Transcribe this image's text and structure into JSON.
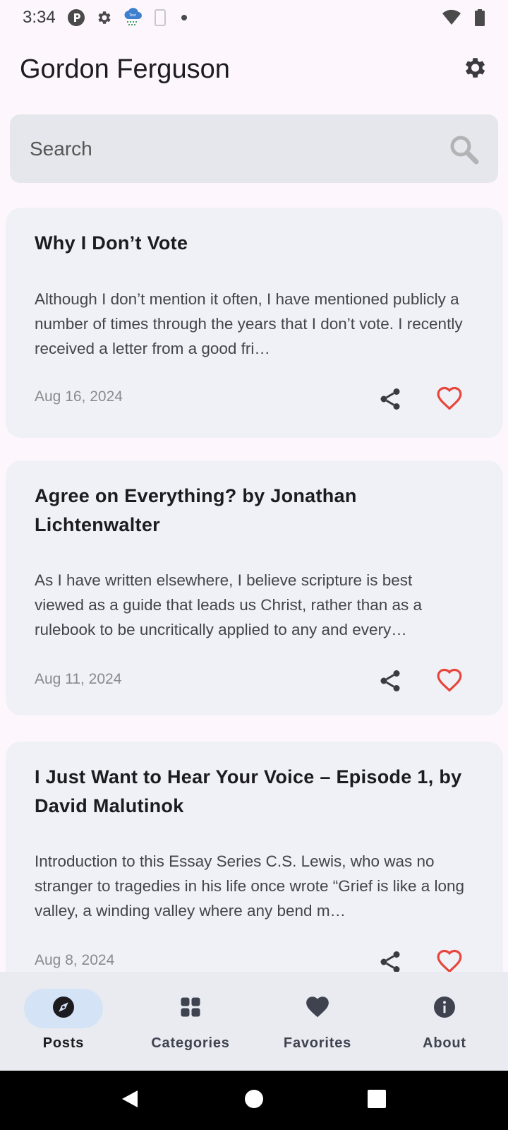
{
  "status_bar": {
    "time": "3:34",
    "left_icons": [
      "p-circle-icon",
      "gear-icon",
      "cloud-test-icon",
      "phone-icon",
      "dot-icon"
    ],
    "right_icons": [
      "wifi-icon",
      "battery-icon"
    ]
  },
  "app_bar": {
    "title": "Gordon Ferguson",
    "settings_icon": "gear-icon"
  },
  "search": {
    "placeholder": "Search",
    "value": ""
  },
  "posts": [
    {
      "title": "Why I Don’t Vote",
      "excerpt": "Although I don’t mention it often, I have mentioned publicly a number of times through the years that I don’t vote. I recently received a letter from a good fri…",
      "date": "Aug 16, 2024"
    },
    {
      "title": "Agree on Everything? by Jonathan Lichtenwalter",
      "excerpt": "As I have written elsewhere, I believe scripture is best viewed as a guide that leads us Christ, rather than as a rulebook to be uncritically applied to any and every…",
      "date": "Aug 11, 2024"
    },
    {
      "title": "I Just Want to Hear Your Voice – Episode 1, by David Malutinok",
      "excerpt": "Introduction to this Essay Series C.S. Lewis, who was no stranger to tragedies in his life once wrote “Grief is like a long valley, a winding valley where any bend m…",
      "date": "Aug 8, 2024"
    }
  ],
  "colors": {
    "favorite": "#e8453c",
    "active_nav_pill": "#d4e4f6",
    "card_background": "#eff1f6"
  },
  "bottom_nav": {
    "items": [
      {
        "label": "Posts",
        "icon": "compass-icon",
        "active": true
      },
      {
        "label": "Categories",
        "icon": "grid-icon",
        "active": false
      },
      {
        "label": "Favorites",
        "icon": "heart-icon",
        "active": false
      },
      {
        "label": "About",
        "icon": "info-icon",
        "active": false
      }
    ]
  }
}
